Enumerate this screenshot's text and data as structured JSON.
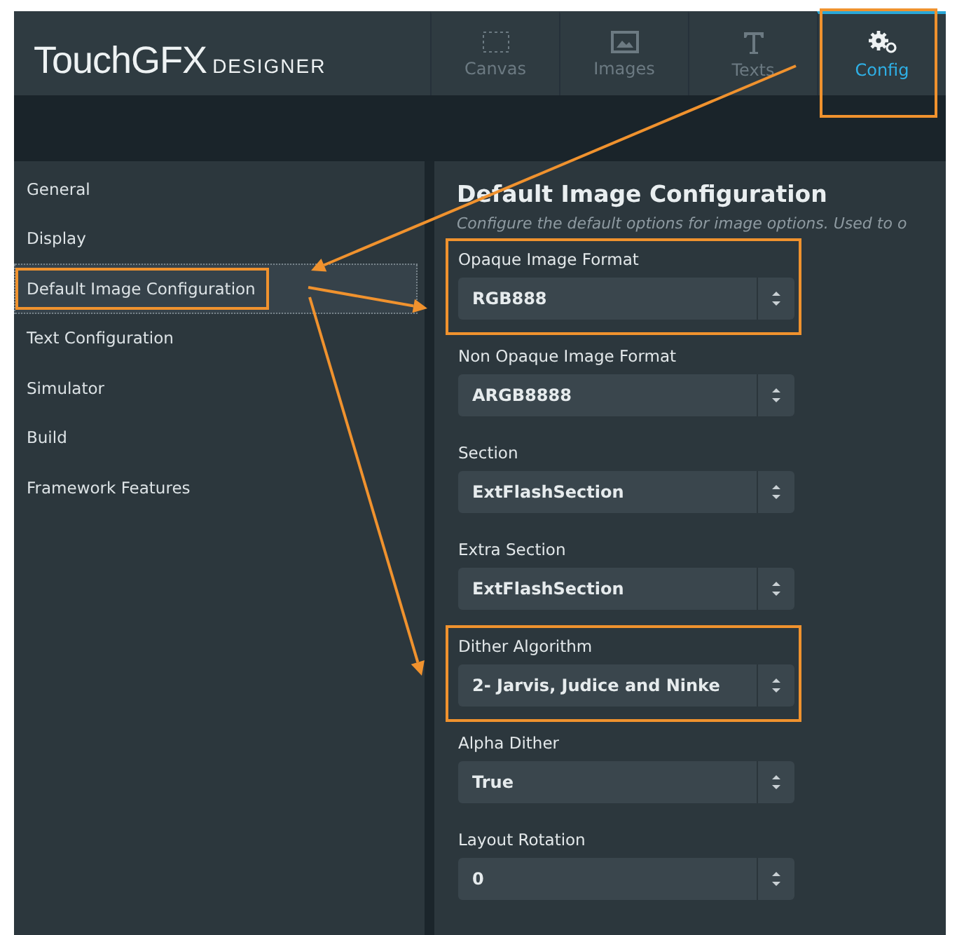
{
  "logo": {
    "main": "TouchGFX",
    "sub": "DESIGNER"
  },
  "tabs": [
    {
      "label": "Canvas",
      "kind": "canvas",
      "selected": false,
      "highlighted": false
    },
    {
      "label": "Images",
      "kind": "images",
      "selected": false,
      "highlighted": false
    },
    {
      "label": "Texts",
      "kind": "texts",
      "selected": false,
      "highlighted": false
    },
    {
      "label": "Config",
      "kind": "config",
      "selected": true,
      "highlighted": true
    }
  ],
  "sidebar": {
    "items": [
      {
        "label": "General",
        "selected": false,
        "highlighted": false
      },
      {
        "label": "Display",
        "selected": false,
        "highlighted": false
      },
      {
        "label": "Default Image Configuration",
        "selected": true,
        "highlighted": true
      },
      {
        "label": "Text Configuration",
        "selected": false,
        "highlighted": false
      },
      {
        "label": "Simulator",
        "selected": false,
        "highlighted": false
      },
      {
        "label": "Build",
        "selected": false,
        "highlighted": false
      },
      {
        "label": "Framework Features",
        "selected": false,
        "highlighted": false
      }
    ]
  },
  "panel": {
    "title": "Default Image Configuration",
    "subtitle": "Configure the default options for image options. Used to o",
    "fields": [
      {
        "label": "Opaque Image Format",
        "value": "RGB888",
        "highlighted": true
      },
      {
        "label": "Non Opaque Image Format",
        "value": "ARGB8888",
        "highlighted": false
      },
      {
        "label": "Section",
        "value": "ExtFlashSection",
        "highlighted": false
      },
      {
        "label": "Extra Section",
        "value": "ExtFlashSection",
        "highlighted": false
      },
      {
        "label": "Dither Algorithm",
        "value": "2- Jarvis, Judice and Ninke",
        "highlighted": true
      },
      {
        "label": "Alpha Dither",
        "value": "True",
        "highlighted": false
      },
      {
        "label": "Layout Rotation",
        "value": "0",
        "highlighted": false
      }
    ]
  }
}
